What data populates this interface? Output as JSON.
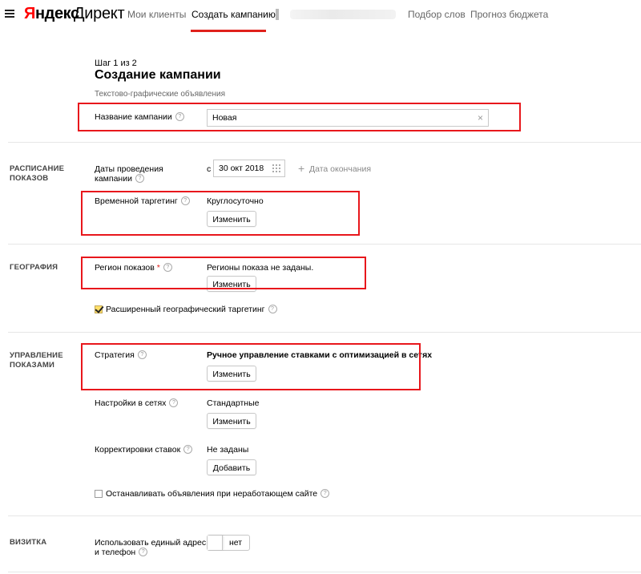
{
  "nav": {
    "logo_yandex_first": "Я",
    "logo_yandex_rest": "ндекс",
    "logo_product": "Директ",
    "items": [
      {
        "label": "Мои клиенты"
      },
      {
        "label": "Создать кампанию"
      },
      {
        "label": "Подбор слов"
      },
      {
        "label": "Прогноз бюджета"
      }
    ],
    "active_index": 1
  },
  "header": {
    "step": "Шаг 1 из 2",
    "title": "Создание кампании",
    "subtitle": "Текстово-графические объявления"
  },
  "campaign_name": {
    "label": "Название кампании",
    "value": "Новая",
    "clear_icon": "×"
  },
  "schedule": {
    "heading_line1": "РАСПИСАНИЕ",
    "heading_line2": "ПОКАЗОВ",
    "dates_label_line1": "Даты проведения",
    "dates_label_line2": "кампании",
    "from_prefix": "с",
    "start_date": "30 окт 2018",
    "end_date_link": "Дата окончания",
    "time_targeting_label": "Временной таргетинг",
    "time_targeting_value": "Круглосуточно",
    "change_button": "Изменить"
  },
  "geo": {
    "heading": "ГЕОГРАФИЯ",
    "region_label": "Регион показов",
    "required_mark": "*",
    "region_value": "Регионы показа не заданы.",
    "change_button": "Изменить",
    "extended_label": "Расширенный географический таргетинг",
    "extended_checked": true
  },
  "management": {
    "heading_line1": "УПРАВЛЕНИЕ",
    "heading_line2": "ПОКАЗАМИ",
    "strategy_label": "Стратегия",
    "strategy_value": "Ручное управление ставками с оптимизацией в сетях",
    "strategy_button": "Изменить",
    "networks_label": "Настройки в сетях",
    "networks_value": "Стандартные",
    "networks_button": "Изменить",
    "bid_adj_label": "Корректировки ставок",
    "bid_adj_value": "Не заданы",
    "bid_adj_button": "Добавить",
    "stop_label": "Останавливать объявления при неработающем сайте",
    "stop_checked": false
  },
  "card": {
    "heading": "ВИЗИТКА",
    "label_line1": "Использовать единый адрес",
    "label_line2": "и телефон",
    "toggle_value": "нет"
  },
  "help_glyph": "?",
  "colors": {
    "accent_red": "#e0211c",
    "highlight_box": "#e8171c",
    "checkbox_fill": "#fedf68"
  }
}
